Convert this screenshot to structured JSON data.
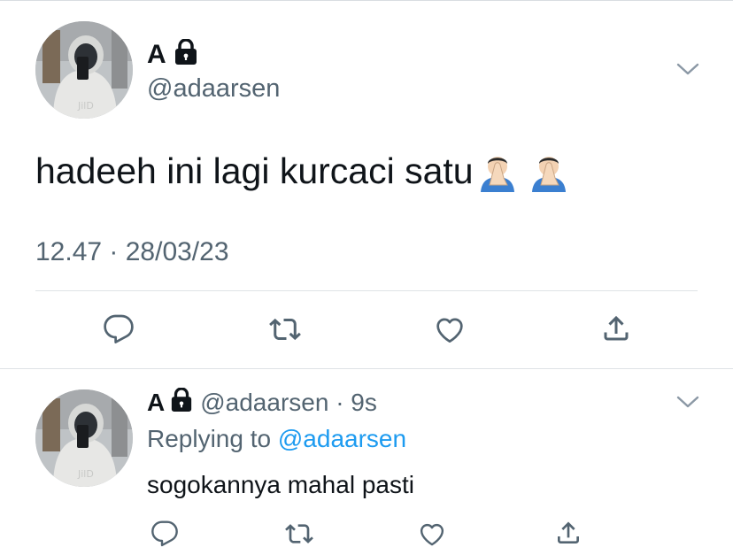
{
  "tweet": {
    "display_name": "A",
    "handle": "@adaarsen",
    "text": "hadeeh ini lagi kurcaci satu",
    "emoji": [
      "facepalm-emoji",
      "facepalm-emoji"
    ],
    "timestamp": "12.47 · 28/03/23",
    "actions": [
      "reply-icon",
      "retweet-icon",
      "like-icon",
      "share-icon"
    ]
  },
  "reply": {
    "display_name": "A",
    "handle_time": "@adaarsen · 9s",
    "replying_prefix": "Replying to",
    "replying_to": "@adaarsen",
    "text": "sogokannya mahal pasti",
    "actions": [
      "reply-icon",
      "retweet-icon",
      "like-icon",
      "share-icon"
    ]
  },
  "colors": {
    "text": "#0f1419",
    "secondary": "#536471",
    "link": "#1d9bf0",
    "divider": "#dfe3e6"
  }
}
